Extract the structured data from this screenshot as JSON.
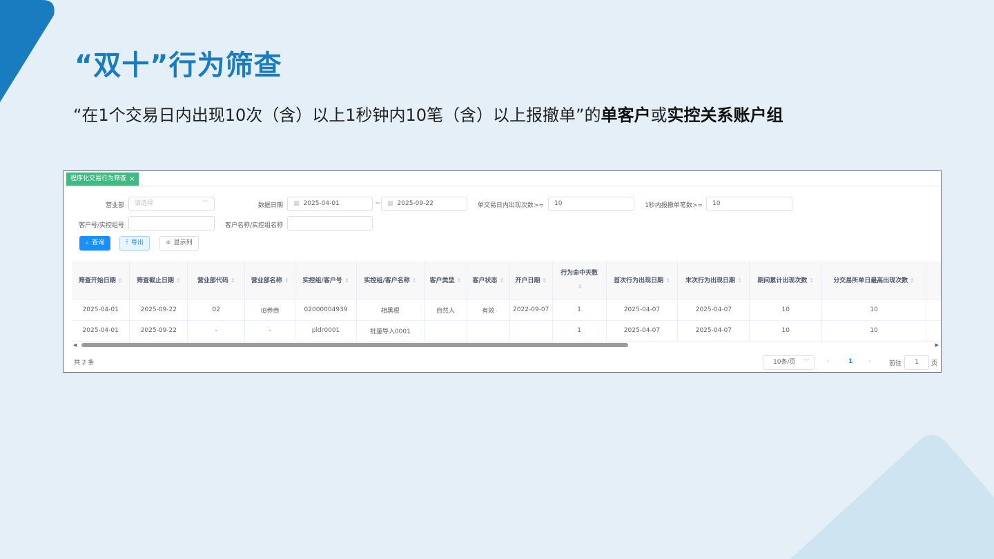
{
  "slide": {
    "title": "“双十”行为筛查",
    "subtitle_prefix": "“在1个交易日内出现10次（含）以上1秒钟内10笔（含）以上报撤单”的",
    "subtitle_bold1": "单客户",
    "subtitle_mid": "或",
    "subtitle_bold2": "实控关系账户组"
  },
  "app": {
    "tab_label": "程序化交易行为筛查",
    "tab_close": "×",
    "form": {
      "dept_label": "营业部",
      "dept_placeholder": "请选择",
      "date_label": "数据日期",
      "date_start": "2025-04-01",
      "date_sep": "~",
      "date_end": "2025-09-22",
      "daily_count_label": "单交易日内出现次数>=",
      "daily_count_value": "10",
      "per_second_label": "1秒内报撤单笔数>=",
      "per_second_value": "10",
      "client_id_label": "客户号/实控组号",
      "client_id_value": "",
      "client_name_label": "客户名称/实控组名称",
      "client_name_value": ""
    },
    "buttons": {
      "query": "查询",
      "export": "导出",
      "columns": "显示列"
    },
    "table": {
      "headers": [
        "筛查开始日期",
        "筛查截止日期",
        "营业部代码",
        "营业部名称",
        "实控组/客户号",
        "实控组/客户名称",
        "客户类型",
        "客户状态",
        "开户日期",
        "行为命中天数",
        "首次行为出现日期",
        "末次行为出现日期",
        "期间累计出现次数",
        "分交易所单日最高出现次数"
      ],
      "rows": [
        [
          "2025-04-01",
          "2025-09-22",
          "02",
          "IB券商",
          "02000004939",
          "相黑根",
          "自然人",
          "有效",
          "2022-09-07",
          "1",
          "2025-04-07",
          "2025-04-07",
          "10",
          "10"
        ],
        [
          "2025-04-01",
          "2025-09-22",
          "-",
          "-",
          "pldr0001",
          "批量导入0001",
          "",
          "",
          "",
          "1",
          "2025-04-07",
          "2025-04-07",
          "10",
          "10"
        ]
      ]
    },
    "pagination": {
      "total": "共 2 条",
      "page_size": "10条/页",
      "current_page": "1",
      "goto_label": "前往",
      "goto_value": "1",
      "goto_unit": "页"
    }
  },
  "icons": {
    "search": "search-icon",
    "export": "upload-icon",
    "columns": "sliders-icon",
    "calendar": "calendar-icon"
  },
  "colors": {
    "title_blue": "#1a7cc0",
    "tab_green": "#42b983",
    "primary_blue": "#1890ff",
    "frame_blue": "#1f7fd0"
  }
}
